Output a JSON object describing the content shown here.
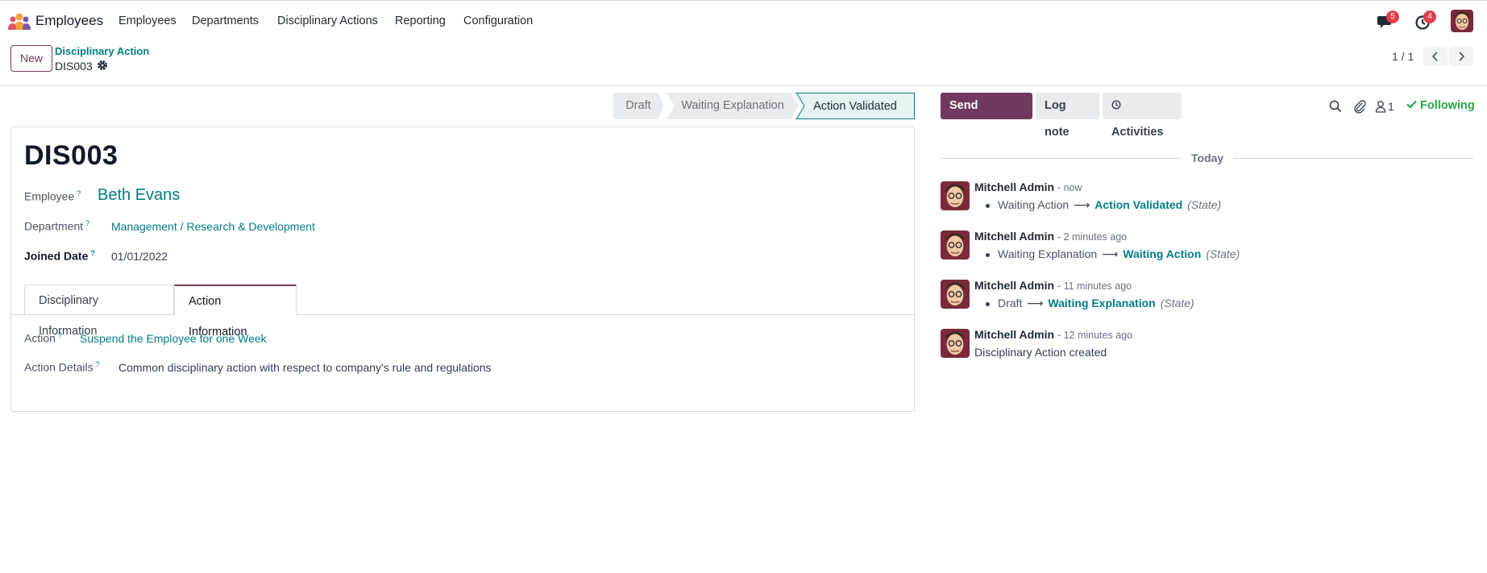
{
  "navbar": {
    "app_name": "Employees",
    "menus": [
      "Employees",
      "Departments",
      "Disciplinary Actions",
      "Reporting",
      "Configuration"
    ],
    "messages_badge": "5",
    "activities_badge": "4"
  },
  "control_panel": {
    "new_label": "New",
    "breadcrumb_parent": "Disciplinary Action",
    "breadcrumb_current": "DIS003",
    "pager_value": "1 / 1"
  },
  "statusbar": {
    "stages": [
      "Draft",
      "Waiting Explanation",
      "Action Validated"
    ],
    "active_stage": "Action Validated"
  },
  "form": {
    "record_name": "DIS003",
    "employee_label": "Employee",
    "employee_value": "Beth Evans",
    "department_label": "Department",
    "department_value": "Management / Research & Development",
    "joined_label": "Joined Date",
    "joined_value": "01/01/2022",
    "help_mark": "?",
    "tabs": [
      "Disciplinary Information",
      "Action Information"
    ],
    "active_tab": "Action Information",
    "action_label": "Action",
    "action_value": "Suspend the Employee for one Week",
    "action_details_label": "Action Details",
    "action_details_value": "Common disciplinary action with respect to company's rule and regulations"
  },
  "chatter": {
    "send_message": "Send message",
    "log_note": "Log note",
    "activities": "Activities",
    "followers_count": "1",
    "following": "Following",
    "date_separator": "Today",
    "messages": [
      {
        "author": "Mitchell Admin",
        "time": "- now",
        "old": "Waiting Action",
        "new": "Action Validated",
        "field": "(State)"
      },
      {
        "author": "Mitchell Admin",
        "time": "- 2 minutes ago",
        "old": "Waiting Explanation",
        "new": "Waiting Action",
        "field": "(State)"
      },
      {
        "author": "Mitchell Admin",
        "time": "- 11 minutes ago",
        "old": "Draft",
        "new": "Waiting Explanation",
        "field": "(State)"
      },
      {
        "author": "Mitchell Admin",
        "time": "- 12 minutes ago",
        "body": "Disciplinary Action created"
      }
    ]
  },
  "colors": {
    "brand": "#71395f",
    "link": "#017e84",
    "following": "#28a745",
    "badge": "#e0404a"
  },
  "icons": [
    "app-logo-icon",
    "chat-icon",
    "clock-icon",
    "gear-icon",
    "chevron-left-icon",
    "chevron-right-icon",
    "search-icon",
    "paperclip-icon",
    "person-icon",
    "check-icon"
  ]
}
